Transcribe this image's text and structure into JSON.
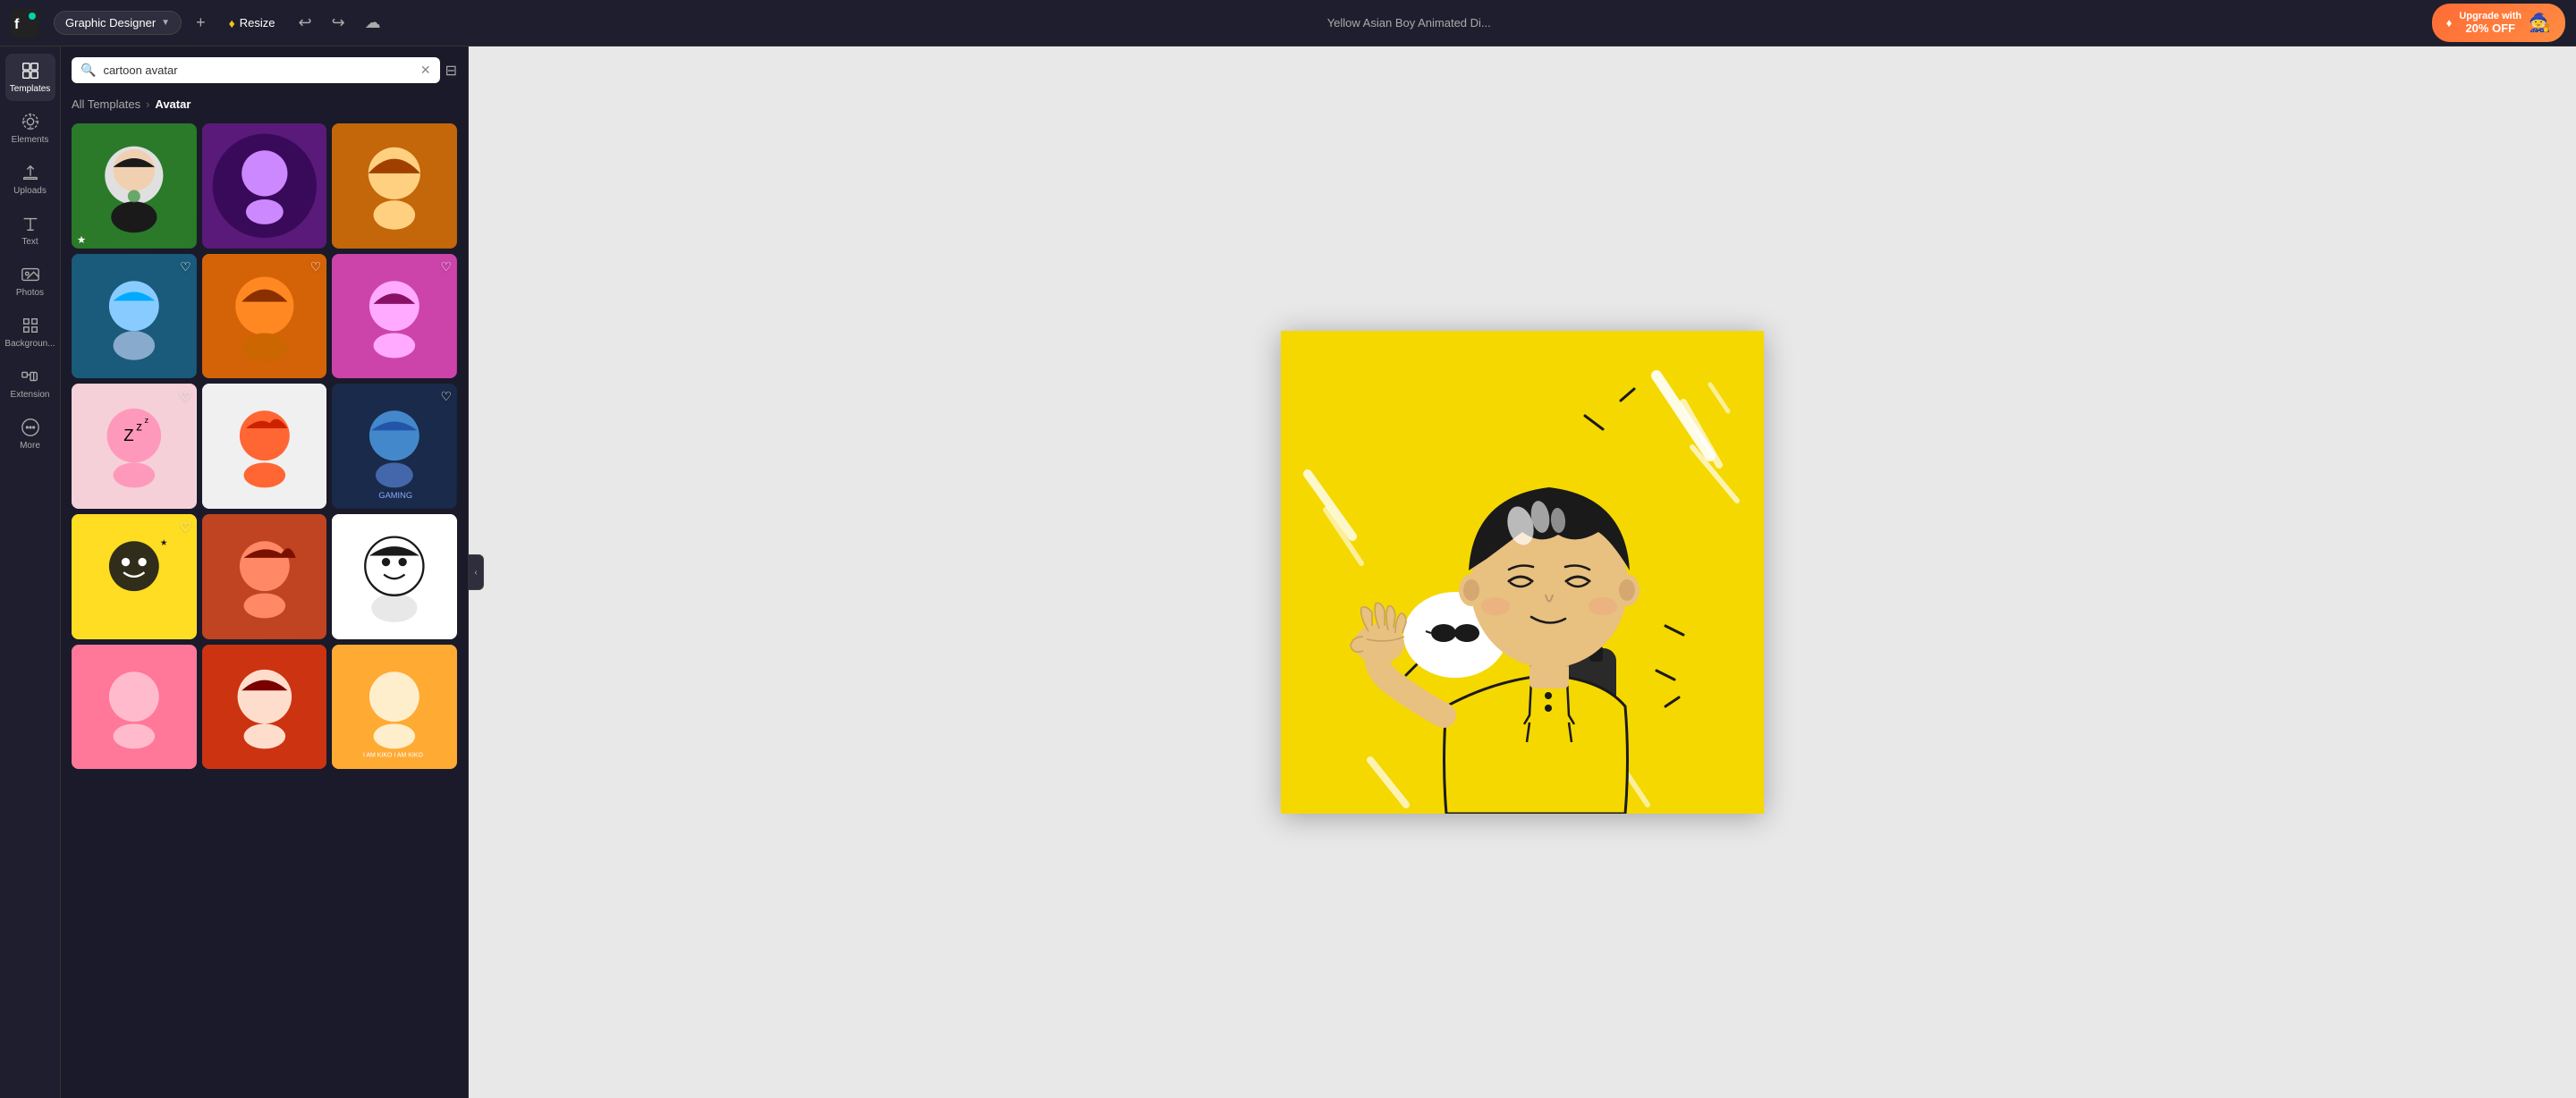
{
  "topbar": {
    "logo": "fotor",
    "tool_label": "Graphic Designer",
    "add_label": "+",
    "resize_label": "Resize",
    "file_title": "Yellow Asian Boy Animated Di...",
    "upgrade_label": "Upgrade with",
    "upgrade_discount": "20% OFF"
  },
  "sidebar": {
    "items": [
      {
        "id": "templates",
        "label": "Templates",
        "active": true
      },
      {
        "id": "elements",
        "label": "Elements",
        "active": false
      },
      {
        "id": "uploads",
        "label": "Uploads",
        "active": false
      },
      {
        "id": "text",
        "label": "Text",
        "active": false
      },
      {
        "id": "photos",
        "label": "Photos",
        "active": false
      },
      {
        "id": "backgrounds",
        "label": "Backgroun...",
        "active": false
      },
      {
        "id": "extension",
        "label": "Extension",
        "active": false
      },
      {
        "id": "more",
        "label": "More",
        "active": false
      }
    ]
  },
  "templates_panel": {
    "search_placeholder": "cartoon avatar",
    "search_value": "cartoon avatar",
    "breadcrumb_all": "All Templates",
    "breadcrumb_current": "Avatar",
    "templates": [
      {
        "id": 1,
        "color": "t1",
        "has_heart": false
      },
      {
        "id": 2,
        "color": "t2",
        "has_heart": false
      },
      {
        "id": 3,
        "color": "t3",
        "has_heart": false
      },
      {
        "id": 4,
        "color": "t4",
        "has_heart": true
      },
      {
        "id": 5,
        "color": "t5",
        "has_heart": true
      },
      {
        "id": 6,
        "color": "t6",
        "has_heart": true
      },
      {
        "id": 7,
        "color": "t7",
        "has_heart": true
      },
      {
        "id": 8,
        "color": "t8",
        "has_heart": false
      },
      {
        "id": 9,
        "color": "t9",
        "has_heart": true
      },
      {
        "id": 10,
        "color": "t10",
        "has_heart": true
      },
      {
        "id": 11,
        "color": "t11",
        "has_heart": false
      },
      {
        "id": 12,
        "color": "t12",
        "has_heart": false
      },
      {
        "id": 13,
        "color": "t13",
        "has_heart": false
      },
      {
        "id": 14,
        "color": "t14",
        "has_heart": false
      },
      {
        "id": 15,
        "color": "t15",
        "has_heart": false
      }
    ]
  },
  "canvas": {
    "title": "Yellow Asian Boy Animated Di..."
  }
}
